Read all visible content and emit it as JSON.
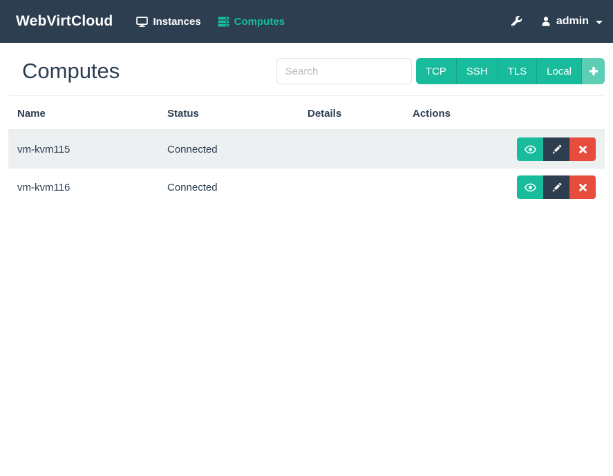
{
  "navbar": {
    "brand": "WebVirtCloud",
    "items": [
      {
        "label": "Instances",
        "icon": "desktop-icon",
        "active": false
      },
      {
        "label": "Computes",
        "icon": "server-icon",
        "active": true
      }
    ],
    "user": {
      "label": "admin",
      "icon": "user-icon"
    }
  },
  "page": {
    "title": "Computes"
  },
  "search": {
    "placeholder": "Search"
  },
  "toolbar": {
    "buttons": [
      "TCP",
      "SSH",
      "TLS",
      "Local"
    ],
    "add_button": "plus-icon"
  },
  "table": {
    "columns": [
      "Name",
      "Status",
      "Details",
      "Actions"
    ],
    "rows": [
      {
        "name": "vm-kvm115",
        "status": "Connected",
        "details": ""
      },
      {
        "name": "vm-kvm116",
        "status": "Connected",
        "details": ""
      }
    ]
  },
  "colors": {
    "navbar": "#2c3e50",
    "accent": "#18bc9c",
    "accent_light": "#5ecdb6",
    "danger": "#e74c3c",
    "stripe": "#edf0f1"
  }
}
